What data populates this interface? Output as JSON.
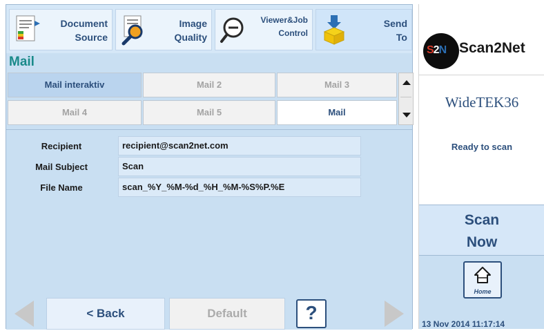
{
  "toolbar": {
    "items": [
      {
        "line1": "Document",
        "line2": "Source"
      },
      {
        "line1": "Image",
        "line2": "Quality"
      },
      {
        "line1": "Viewer&Job",
        "line2": "Control"
      },
      {
        "line1": "Send",
        "line2": "To"
      }
    ]
  },
  "section_title": "Mail",
  "tabs": [
    {
      "label": "Mail interaktiv",
      "state": "active"
    },
    {
      "label": "Mail 2",
      "state": "inactive"
    },
    {
      "label": "Mail 3",
      "state": "inactive"
    },
    {
      "label": "Mail 4",
      "state": "inactive"
    },
    {
      "label": "Mail 5",
      "state": "inactive"
    },
    {
      "label": "Mail",
      "state": "current"
    }
  ],
  "form": {
    "recipient_label": "Recipient",
    "recipient_value": "recipient@scan2net.com",
    "subject_label": "Mail Subject",
    "subject_value": "Scan",
    "filename_label": "File Name",
    "filename_value": "scan_%Y_%M-%d_%H_%M-%S%P.%E"
  },
  "nav": {
    "back_label": "< Back",
    "default_label": "Default",
    "help_label": "?"
  },
  "side": {
    "logo_mark": "S2N",
    "logo_text": "Scan2Net",
    "device_name": "WideTEK36",
    "status": "Ready to scan",
    "scan_line1": "Scan",
    "scan_line2": "Now",
    "home_label": "Home",
    "datetime": "13 Nov 2014 11:17:14"
  },
  "colors": {
    "panel": "#c9dff2",
    "accent_text": "#2c4f7c",
    "title_teal": "#1a8a8a"
  }
}
